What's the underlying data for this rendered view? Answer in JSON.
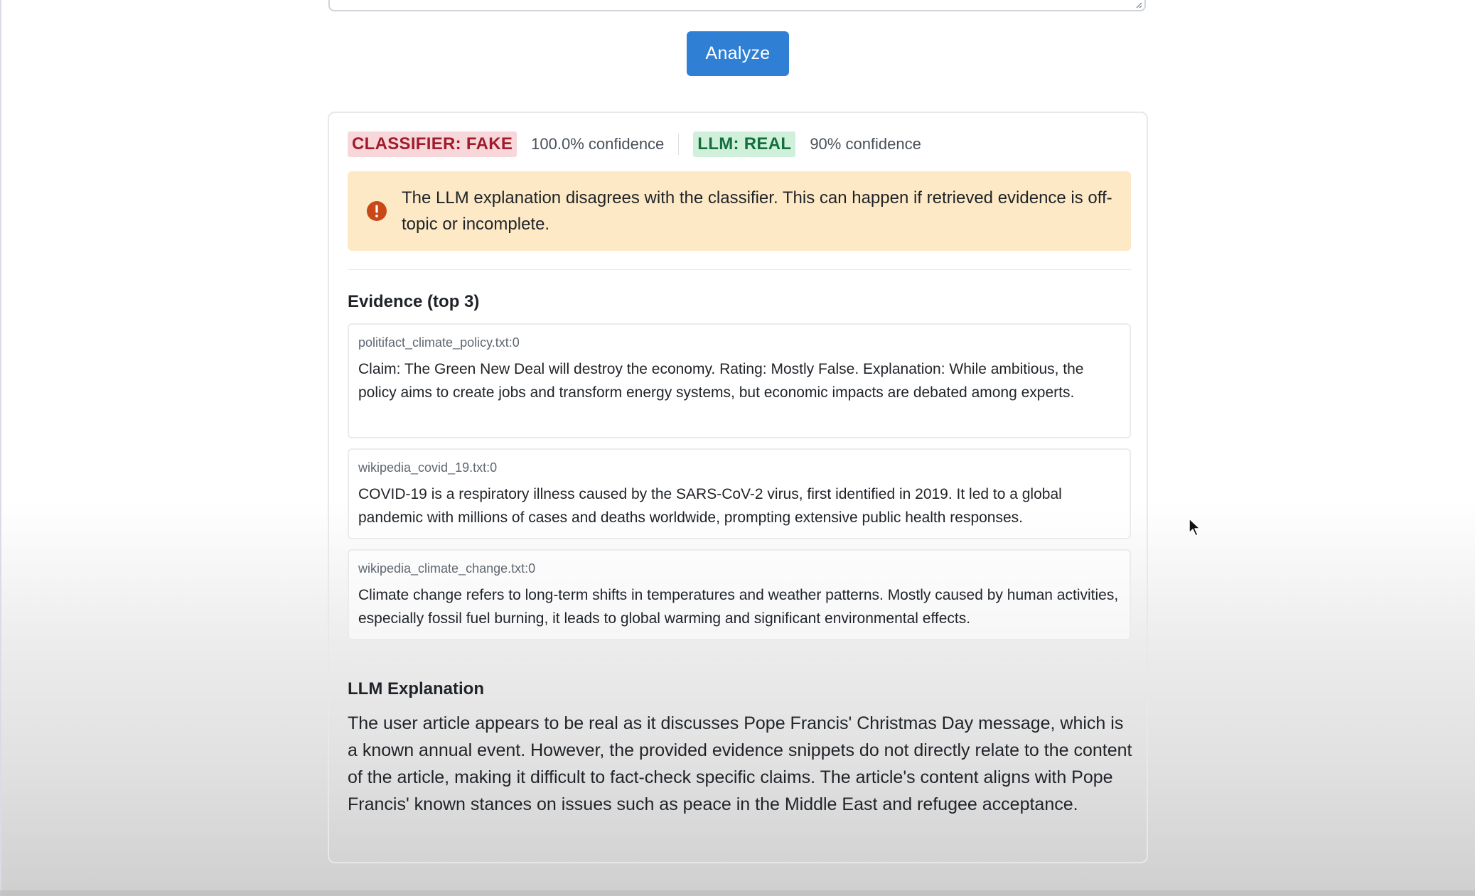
{
  "analyze_button": {
    "label": "Analyze"
  },
  "verdicts": {
    "classifier_label": "CLASSIFIER: FAKE",
    "classifier_confidence": "100.0% confidence",
    "llm_label": "LLM: REAL",
    "llm_confidence": "90% confidence"
  },
  "alert": {
    "icon": "exclamation-circle-icon",
    "text": "The LLM explanation disagrees with the classifier. This can happen if retrieved evidence is off-topic or incomplete."
  },
  "evidence": {
    "title": "Evidence (top 3)",
    "items": [
      {
        "source": "politifact_climate_policy.txt:0",
        "text": "Claim: The Green New Deal will destroy the economy. Rating: Mostly False. Explanation: While ambitious, the policy aims to create jobs and transform energy systems, but economic impacts are debated among experts."
      },
      {
        "source": "wikipedia_covid_19.txt:0",
        "text": "COVID-19 is a respiratory illness caused by the SARS-CoV-2 virus, first identified in 2019. It led to a global pandemic with millions of cases and deaths worldwide, prompting extensive public health responses."
      },
      {
        "source": "wikipedia_climate_change.txt:0",
        "text": "Climate change refers to long-term shifts in temperatures and weather patterns. Mostly caused by human activities, especially fossil fuel burning, it leads to global warming and significant environmental effects."
      }
    ]
  },
  "explanation": {
    "title": "LLM Explanation",
    "text": "The user article appears to be real as it discusses Pope Francis' Christmas Day message, which is a known annual event. However, the provided evidence snippets do not directly relate to the content of the article, making it difficult to fact-check specific claims. The article's content aligns with Pope Francis' known stances on issues such as peace in the Middle East and refugee acceptance."
  },
  "colors": {
    "accent": "#2f80d5",
    "fake_badge_bg": "#f8d7da",
    "fake_badge_text": "#a01c2c",
    "real_badge_bg": "#d1f0dc",
    "real_badge_text": "#13703c",
    "alert_bg": "#fde9c5",
    "alert_icon": "#c9481a"
  }
}
